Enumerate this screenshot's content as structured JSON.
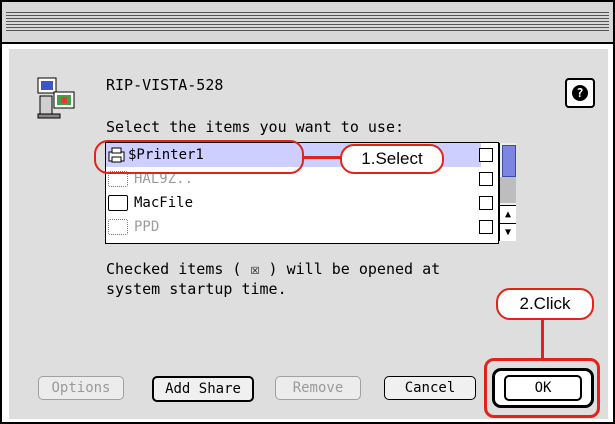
{
  "window": {
    "title": "RIP-VISTA-528"
  },
  "dialog": {
    "instruction": "Select the items you want to use:",
    "items": [
      {
        "label": "$Printer1",
        "icon": "printer-icon",
        "selected": true
      },
      {
        "label": "HAL9Z..",
        "icon": "folder-dim-icon",
        "selected": false
      },
      {
        "label": "MacFile",
        "icon": "folder-icon",
        "selected": false
      },
      {
        "label": "PPD",
        "icon": "folder-dim-icon",
        "selected": false
      }
    ],
    "checked_note_line1": "Checked items ( ☒ ) will be opened at",
    "checked_note_line2": "system startup time.",
    "help_glyph": "?"
  },
  "buttons": {
    "options": "Options",
    "add_share": "Add Share",
    "remove": "Remove",
    "cancel": "Cancel",
    "ok": "OK"
  },
  "annotations": {
    "step1": "1.Select",
    "step2": "2.Click"
  },
  "colors": {
    "highlight": "#cccfff",
    "annotation_red": "#e2231a"
  }
}
